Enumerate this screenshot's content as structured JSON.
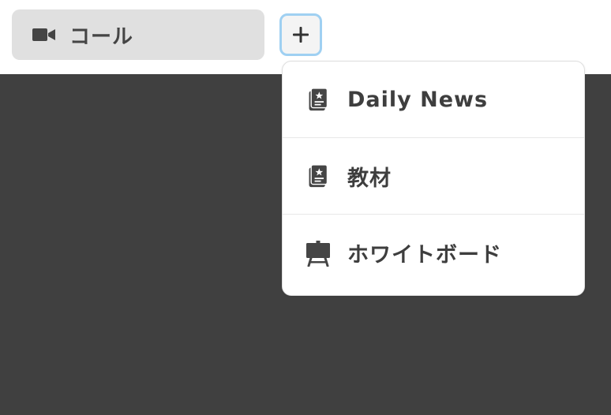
{
  "tabs": {
    "call_label": "コール",
    "call_icon": "video-camera-icon",
    "add_icon": "plus-icon"
  },
  "menu": {
    "items": [
      {
        "label": "Daily News",
        "icon": "book-star-icon"
      },
      {
        "label": "教材",
        "icon": "book-star-icon"
      },
      {
        "label": "ホワイトボード",
        "icon": "easel-whiteboard-icon"
      }
    ]
  },
  "colors": {
    "content_bg": "#404040",
    "tab_bg": "#e0e0e0",
    "focus_ring": "#9fd0f2",
    "icon": "#454545"
  }
}
